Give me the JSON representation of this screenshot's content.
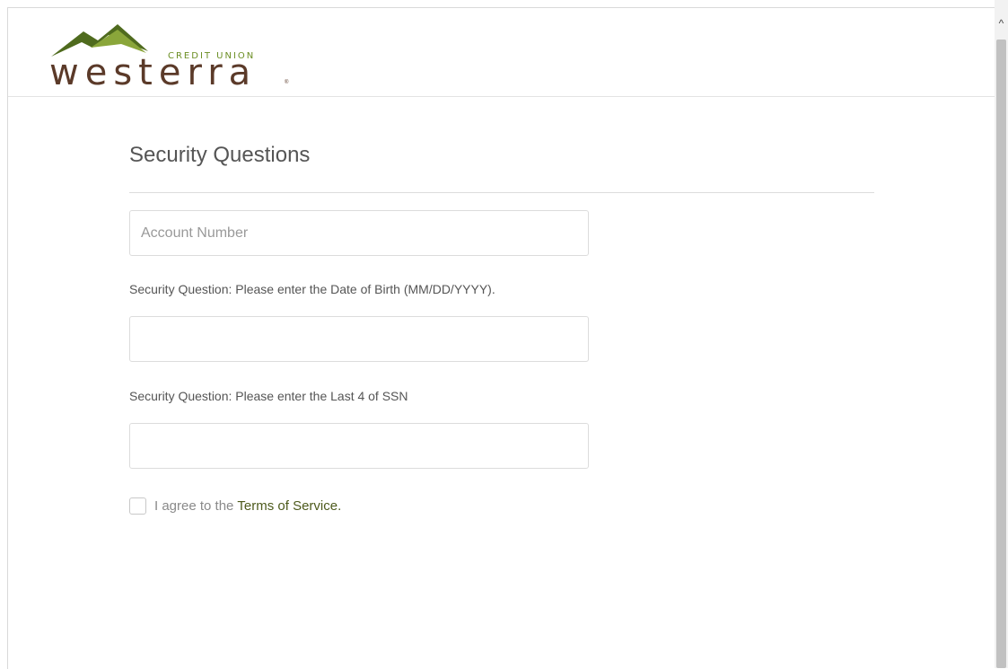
{
  "brand": {
    "name": "westerra",
    "tagline": "CREDIT UNION",
    "colors": {
      "mountain_dark": "#4f6b1e",
      "mountain_light": "#8aa63a",
      "wordmark": "#5b3a29",
      "link": "#4d5a1c"
    }
  },
  "page": {
    "title": "Security Questions"
  },
  "form": {
    "account_number": {
      "placeholder": "Account Number",
      "value": ""
    },
    "dob_question": {
      "label": "Security Question: Please enter the Date of Birth (MM/DD/YYYY).",
      "value": ""
    },
    "ssn_question": {
      "label": "Security Question: Please enter the Last 4 of SSN",
      "value": ""
    },
    "agree": {
      "text": "I agree to the",
      "link_text": "Terms of Service.",
      "checked": false
    }
  },
  "scrollbar": {
    "up_icon": "chevron-up-icon"
  }
}
